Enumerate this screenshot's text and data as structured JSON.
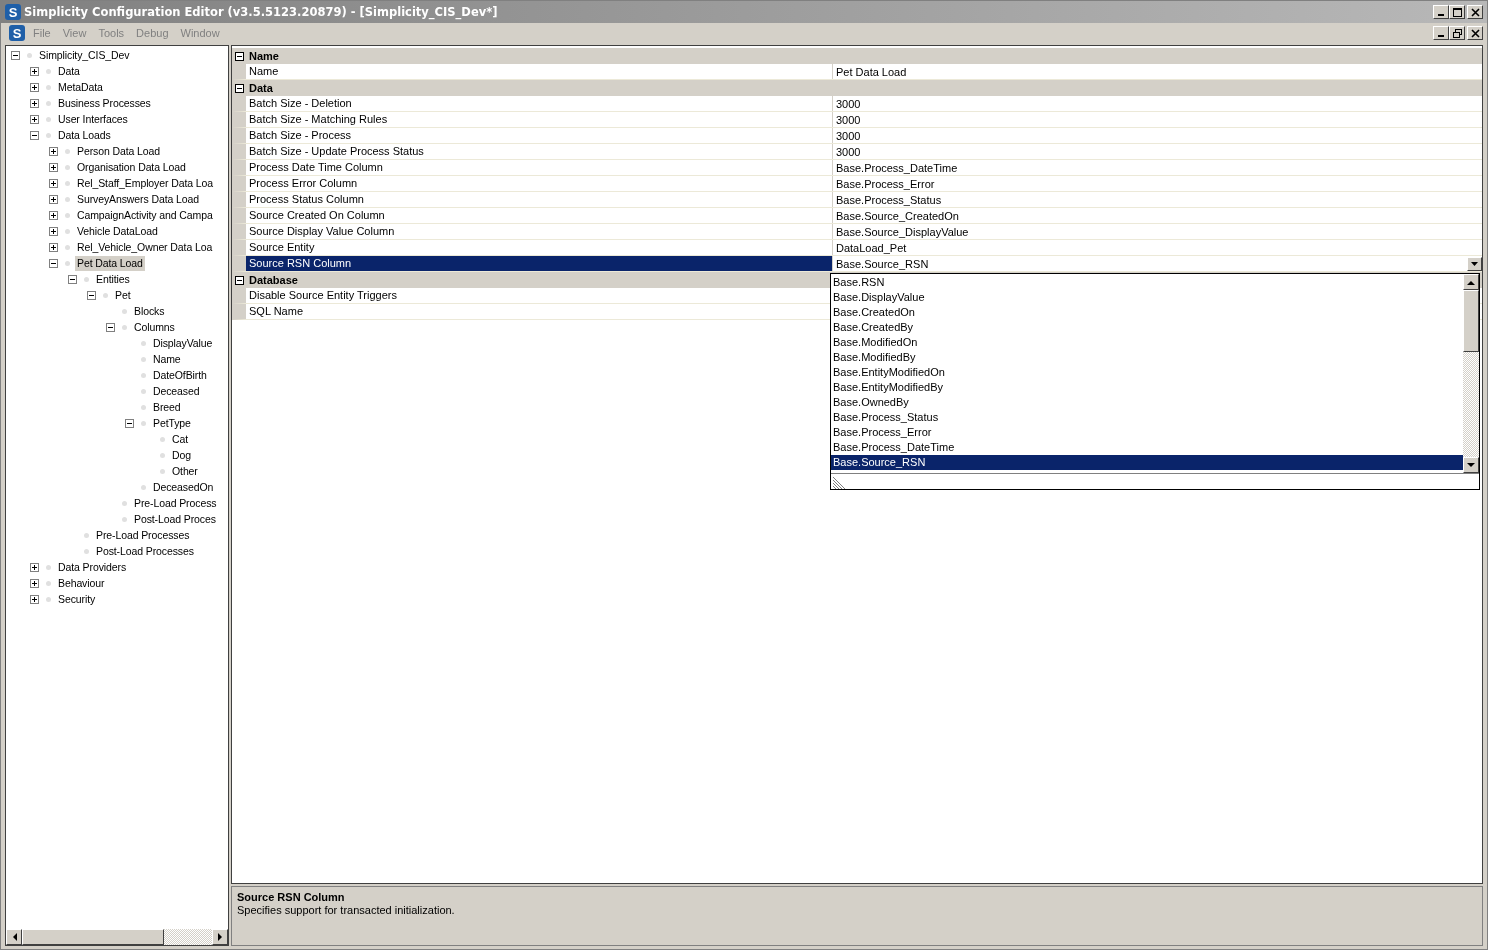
{
  "title_bar": {
    "logo": "S",
    "title": "Simplicity Configuration Editor (v3.5.5123.20879) - [Simplicity_CIS_Dev*]"
  },
  "menu_bar": {
    "logo": "S",
    "items": [
      {
        "label": "File",
        "disabled": true
      },
      {
        "label": "View",
        "disabled": true
      },
      {
        "label": "Tools",
        "disabled": true
      },
      {
        "label": "Debug",
        "disabled": true
      },
      {
        "label": "Window",
        "disabled": true
      }
    ]
  },
  "tree": [
    {
      "label": "Simplicity_CIS_Dev",
      "expanded": true,
      "selected": false,
      "children": [
        {
          "label": "Data",
          "expanded": false,
          "selected": false
        },
        {
          "label": "MetaData",
          "expanded": false,
          "selected": false
        },
        {
          "label": "Business Processes",
          "expanded": false,
          "selected": false
        },
        {
          "label": "User Interfaces",
          "expanded": false,
          "selected": false
        },
        {
          "label": "Data Loads",
          "expanded": true,
          "selected": false,
          "children": [
            {
              "label": "Person Data Load",
              "expanded": false,
              "selected": false
            },
            {
              "label": "Organisation Data Load",
              "expanded": false,
              "selected": false
            },
            {
              "label": "Rel_Staff_Employer Data Loa",
              "expanded": false,
              "selected": false
            },
            {
              "label": "SurveyAnswers Data Load",
              "expanded": false,
              "selected": false
            },
            {
              "label": "CampaignActivity and Campa",
              "expanded": false,
              "selected": false
            },
            {
              "label": "Vehicle DataLoad",
              "expanded": false,
              "selected": false
            },
            {
              "label": "Rel_Vehicle_Owner Data Loa",
              "expanded": false,
              "selected": false
            },
            {
              "label": "Pet Data Load",
              "expanded": true,
              "selected": true,
              "children": [
                {
                  "label": "Entities",
                  "expanded": true,
                  "selected": false,
                  "children": [
                    {
                      "label": "Pet",
                      "expanded": true,
                      "selected": false,
                      "children": [
                        {
                          "label": "Blocks",
                          "selected": false
                        },
                        {
                          "label": "Columns",
                          "expanded": true,
                          "selected": false,
                          "children": [
                            {
                              "label": "DisplayValue",
                              "selected": false
                            },
                            {
                              "label": "Name",
                              "selected": false
                            },
                            {
                              "label": "DateOfBirth",
                              "selected": false
                            },
                            {
                              "label": "Deceased",
                              "selected": false
                            },
                            {
                              "label": "Breed",
                              "selected": false
                            },
                            {
                              "label": "PetType",
                              "expanded": true,
                              "selected": false,
                              "children": [
                                {
                                  "label": "Cat",
                                  "selected": false
                                },
                                {
                                  "label": "Dog",
                                  "selected": false
                                },
                                {
                                  "label": "Other",
                                  "selected": false
                                }
                              ]
                            },
                            {
                              "label": "DeceasedOn",
                              "selected": false
                            }
                          ]
                        },
                        {
                          "label": "Pre-Load Process",
                          "selected": false
                        },
                        {
                          "label": "Post-Load Proces",
                          "selected": false
                        }
                      ]
                    }
                  ]
                },
                {
                  "label": "Pre-Load Processes",
                  "selected": false
                },
                {
                  "label": "Post-Load Processes",
                  "selected": false
                }
              ]
            }
          ]
        },
        {
          "label": "Data Providers",
          "expanded": false,
          "selected": false
        },
        {
          "label": "Behaviour",
          "expanded": false,
          "selected": false
        },
        {
          "label": "Security",
          "expanded": false,
          "selected": false
        }
      ]
    }
  ],
  "property_grid": {
    "categories": [
      {
        "label": "Name",
        "expanded": true,
        "rows": [
          {
            "name": "Name",
            "value": "Pet Data Load",
            "selected": false
          }
        ]
      },
      {
        "label": "Data",
        "expanded": true,
        "rows": [
          {
            "name": "Batch Size - Deletion",
            "value": "3000",
            "selected": false
          },
          {
            "name": "Batch Size - Matching Rules",
            "value": "3000",
            "selected": false
          },
          {
            "name": "Batch Size - Process",
            "value": "3000",
            "selected": false
          },
          {
            "name": "Batch Size - Update Process Status",
            "value": "3000",
            "selected": false
          },
          {
            "name": "Process Date Time Column",
            "value": "Base.Process_DateTime",
            "selected": false
          },
          {
            "name": "Process Error Column",
            "value": "Base.Process_Error",
            "selected": false
          },
          {
            "name": "Process Status Column",
            "value": "Base.Process_Status",
            "selected": false
          },
          {
            "name": "Source Created On Column",
            "value": "Base.Source_CreatedOn",
            "selected": false
          },
          {
            "name": "Source Display Value Column",
            "value": "Base.Source_DisplayValue",
            "selected": false
          },
          {
            "name": "Source Entity",
            "value": "DataLoad_Pet",
            "selected": false
          },
          {
            "name": "Source RSN Column",
            "value": "Base.Source_RSN",
            "selected": true
          }
        ]
      },
      {
        "label": "Database",
        "expanded": true,
        "rows": [
          {
            "name": "Disable Source Entity Triggers",
            "value": "",
            "selected": false
          },
          {
            "name": "SQL Name",
            "value": "",
            "selected": false
          }
        ]
      }
    ]
  },
  "dropdown": {
    "items": [
      {
        "label": "Base.RSN",
        "selected": false
      },
      {
        "label": "Base.DisplayValue",
        "selected": false
      },
      {
        "label": "Base.CreatedOn",
        "selected": false
      },
      {
        "label": "Base.CreatedBy",
        "selected": false
      },
      {
        "label": "Base.ModifiedOn",
        "selected": false
      },
      {
        "label": "Base.ModifiedBy",
        "selected": false
      },
      {
        "label": "Base.EntityModifiedOn",
        "selected": false
      },
      {
        "label": "Base.EntityModifiedBy",
        "selected": false
      },
      {
        "label": "Base.OwnedBy",
        "selected": false
      },
      {
        "label": "Base.Process_Status",
        "selected": false
      },
      {
        "label": "Base.Process_Error",
        "selected": false
      },
      {
        "label": "Base.Process_DateTime",
        "selected": false
      },
      {
        "label": "Base.Source_RSN",
        "selected": true
      }
    ]
  },
  "description": {
    "title": "Source RSN Column",
    "text": "Specifies support for transacted initialization."
  }
}
